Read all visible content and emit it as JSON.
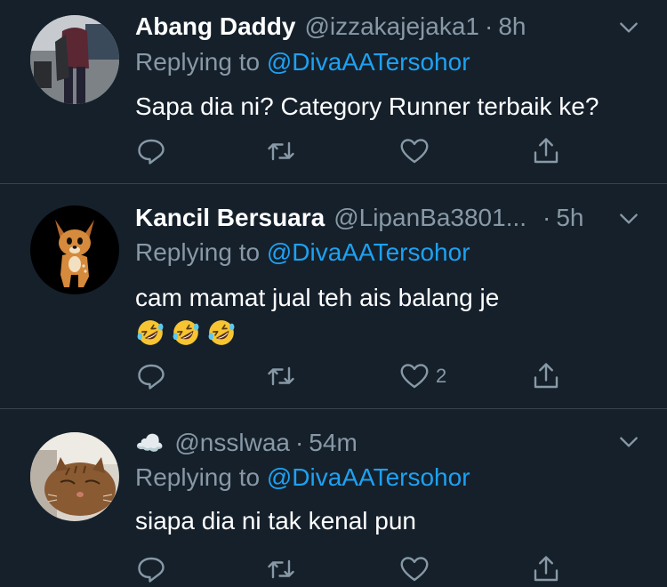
{
  "colors": {
    "background": "#15202b",
    "divider": "#38444d",
    "text_primary": "#ffffff",
    "text_secondary": "#8899a6",
    "accent": "#1da1f2"
  },
  "tweets": [
    {
      "display_name": "Abang Daddy",
      "handle": "@izzakajejaka1",
      "time": "8h",
      "reply_prefix": "Replying to",
      "reply_to": "@DivaAATersohor",
      "text": "Sapa dia ni? Category Runner terbaik ke?",
      "emojis": [],
      "like_count": "",
      "avatar": "photo of man with backpack"
    },
    {
      "display_name": "Kancil Bersuara",
      "handle": "@LipanBa3801...",
      "time": "5h",
      "reply_prefix": "Replying to",
      "reply_to": "@DivaAATersohor",
      "text": "cam mamat jual teh ais balang je",
      "emojis": [
        "rolling-on-floor-laughing-emoji",
        "rolling-on-floor-laughing-emoji",
        "rolling-on-floor-laughing-emoji"
      ],
      "like_count": "2",
      "avatar": "cartoon fawn"
    },
    {
      "display_name": "☁️",
      "handle": "@nsslwaa",
      "time": "54m",
      "reply_prefix": "Replying to",
      "reply_to": "@DivaAATersohor",
      "text": "siapa dia ni tak kenal pun",
      "emojis": [],
      "like_count": "",
      "avatar": "photo of tabby cat"
    }
  ],
  "icons": {
    "reply": "reply-icon",
    "retweet": "retweet-icon",
    "like": "heart-icon",
    "share": "share-icon",
    "more": "chevron-down-icon"
  },
  "separator": "·"
}
